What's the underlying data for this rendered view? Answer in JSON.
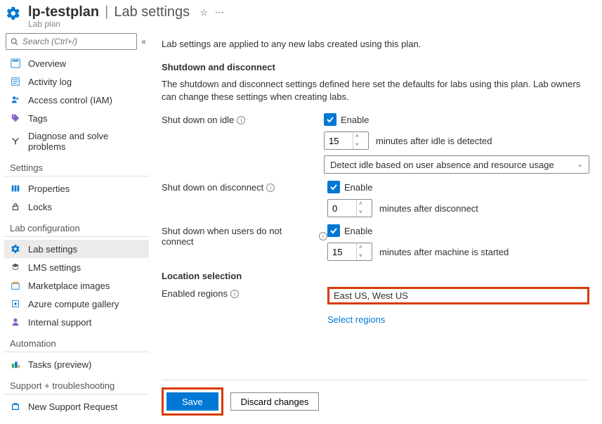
{
  "header": {
    "title_main": "lp-testplan",
    "title_sub": "Lab settings",
    "subtitle": "Lab plan"
  },
  "search": {
    "placeholder": "Search (Ctrl+/)"
  },
  "sidebar": {
    "top": [
      {
        "icon": "overview",
        "label": "Overview"
      },
      {
        "icon": "activity",
        "label": "Activity log"
      },
      {
        "icon": "access",
        "label": "Access control (IAM)"
      },
      {
        "icon": "tags",
        "label": "Tags"
      },
      {
        "icon": "diagnose",
        "label": "Diagnose and solve problems"
      }
    ],
    "sections": [
      {
        "title": "Settings",
        "items": [
          {
            "icon": "props",
            "label": "Properties"
          },
          {
            "icon": "locks",
            "label": "Locks"
          }
        ]
      },
      {
        "title": "Lab configuration",
        "items": [
          {
            "icon": "gear",
            "label": "Lab settings",
            "active": true
          },
          {
            "icon": "lms",
            "label": "LMS settings"
          },
          {
            "icon": "market",
            "label": "Marketplace images"
          },
          {
            "icon": "compute",
            "label": "Azure compute gallery"
          },
          {
            "icon": "support",
            "label": "Internal support"
          }
        ]
      },
      {
        "title": "Automation",
        "items": [
          {
            "icon": "tasks",
            "label": "Tasks (preview)"
          }
        ]
      },
      {
        "title": "Support + troubleshooting",
        "items": [
          {
            "icon": "newreq",
            "label": "New Support Request"
          }
        ]
      }
    ]
  },
  "main": {
    "intro": "Lab settings are applied to any new labs created using this plan.",
    "shutdown": {
      "title": "Shutdown and disconnect",
      "desc": "The shutdown and disconnect settings defined here set the defaults for labs using this plan. Lab owners can change these settings when creating labs.",
      "idle_label": "Shut down on idle",
      "disconnect_label": "Shut down on disconnect",
      "noconnect_label": "Shut down when users do not connect",
      "enable_label": "Enable",
      "idle_minutes": "15",
      "idle_suffix": "minutes after idle is detected",
      "idle_dropdown": "Detect idle based on user absence and resource usage",
      "disconnect_minutes": "0",
      "disconnect_suffix": "minutes after disconnect",
      "noconnect_minutes": "15",
      "noconnect_suffix": "minutes after machine is started"
    },
    "location": {
      "title": "Location selection",
      "label": "Enabled regions",
      "value": "East US, West US",
      "link": "Select regions"
    },
    "footer": {
      "save": "Save",
      "discard": "Discard changes"
    }
  }
}
